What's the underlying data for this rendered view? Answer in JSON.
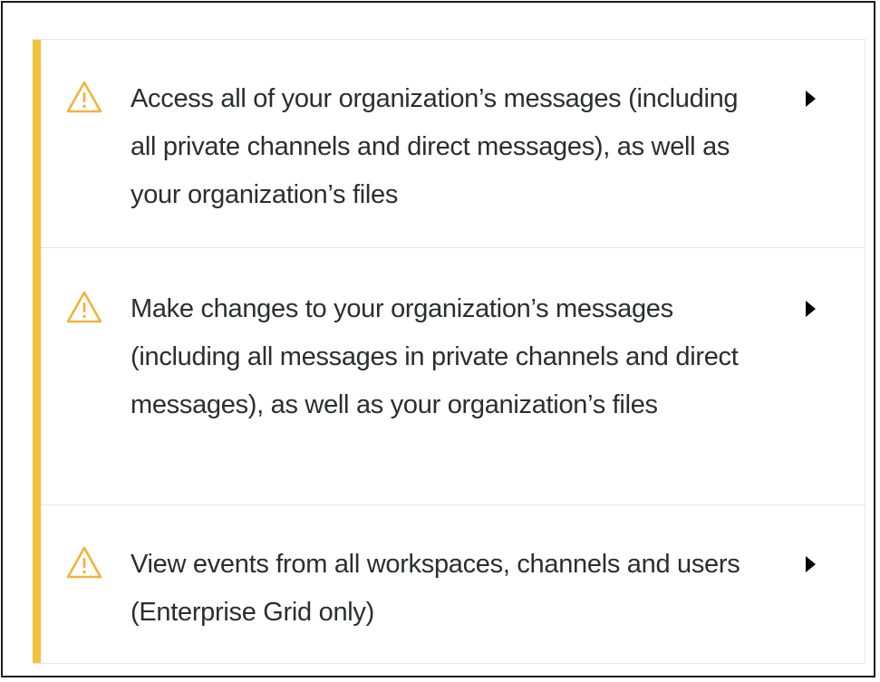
{
  "permissions": [
    {
      "text": "Access all of your organization’s messages (including all private channels and direct messages), as well as your organization’s files"
    },
    {
      "text": "Make changes to your organization’s messages (including all messages in private channels and direct messages), as well as your organization’s files"
    },
    {
      "text": "View events from all workspaces, channels and users (Enterprise Grid only)"
    }
  ],
  "colors": {
    "accent": "#f2c23d",
    "warning_icon": "#f2b33d",
    "text": "#2c2d30",
    "divider": "#e4e4e4"
  },
  "icons": {
    "row_icon": "warning-triangle-icon",
    "expand_icon": "caret-right-icon"
  }
}
